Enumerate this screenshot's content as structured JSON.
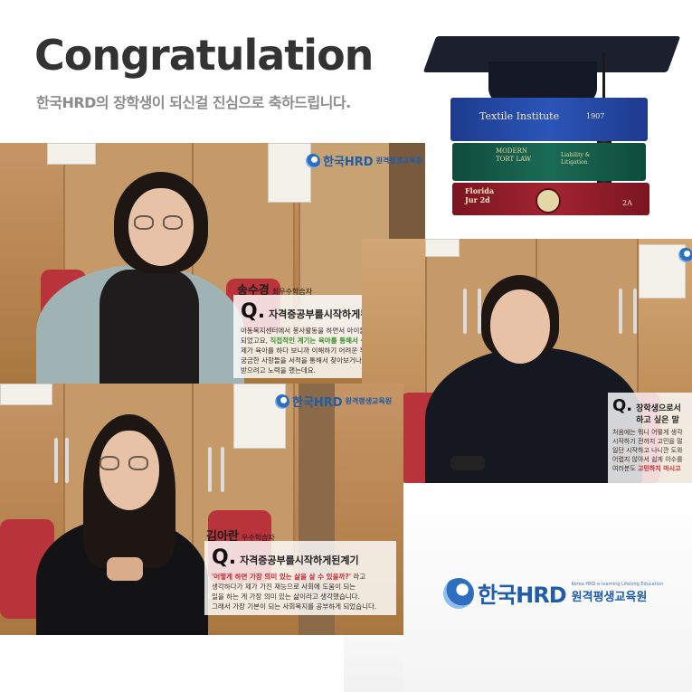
{
  "header": {
    "title": "Congratulation",
    "subtitle": "한국HRD의 장학생이 되신걸 진심으로 축하드립니다."
  },
  "books": {
    "top": "Textile Institute",
    "top_side": "1907",
    "middle": "MODERN TORT LAW",
    "middle_side": "Liability & Litigation",
    "bottom": "Florida Jur 2d",
    "bottom_side": "2A"
  },
  "photos": [
    {
      "name": "송수경",
      "role": "최우수학습자",
      "question": "자격증공부를시작하게된계기",
      "answer_pre": "아동복지센터에서 봉사활동을 하면서 아이들한테 관심을 갖게 되었고요, ",
      "answer_highlight": "직접적인 계기는 육아를 통해서 생겼는데요.",
      "answer_post": "\n제가 육아를 하다 보니까 이해하기 어려운 부분이 있거나,\n궁금한 사항들을 서적을 통해서 찾아보거나 전문가의 도움을\n받으려고 노력을 했는데요.",
      "logo": "한국HRD",
      "logo_sub": "원격평생교육원"
    },
    {
      "name": "김아란",
      "role": "우수학습자",
      "question": "자격증공부를시작하게된계기",
      "answer_highlight": "'어떻게 하면 가장 의미 있는 삶을 살 수 있을까?'",
      "answer_post": " 라고\n생각하다가 제가 가진 재능으로 사회에 도움이 되는\n일을 하는 게 가장 의미 있는 삶이라고 생각했습니다.\n그래서 가장 기본이 되는 사회복지를 공부하게 되었습니다.",
      "logo": "한국HRD",
      "logo_sub": "원격평생교육원"
    },
    {
      "question": "장학생으로서 하고 싶은 말",
      "answer_pre": "처음에는 뭐니 어떻게 생각\n시작하기 전까지 고민을 많\n일단 시작하고 나니깐 도와\n어렵지 않아서 쉽게 이수를\n여러분도 ",
      "answer_highlight": "고민하지 마시고",
      "logo": "한국HRD"
    }
  ],
  "brand": {
    "name": "한국HRD",
    "tagline": "Korea HRD e-learning Lifelong Education",
    "sub": "원격평생교육원"
  }
}
